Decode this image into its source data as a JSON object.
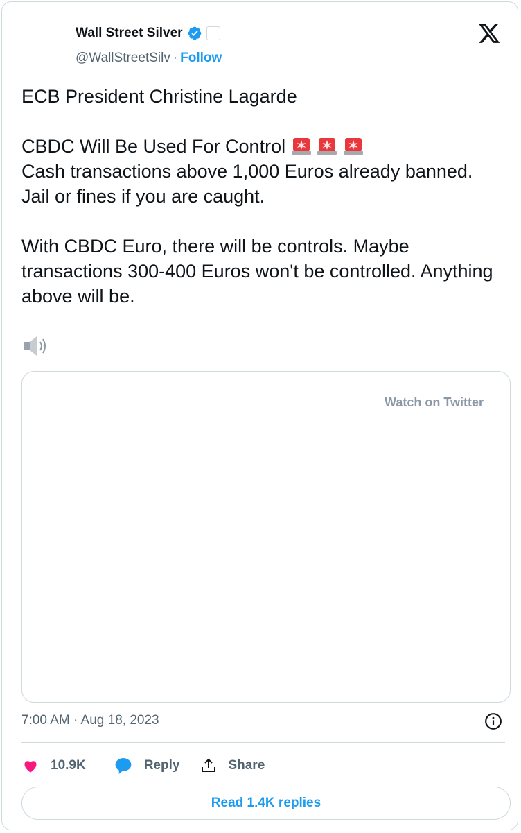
{
  "author": {
    "name": "Wall Street Silver",
    "handle": "@WallStreetSilv",
    "separator": "·",
    "follow_label": "Follow"
  },
  "tweet": {
    "line1": "ECB President Christine Lagarde",
    "line2": "CBDC Will Be Used For Control",
    "emoji": "rotating-light-emoji",
    "line3": "Cash transactions above 1,000 Euros already banned. Jail or fines if you are caught.",
    "line4": "With CBDC Euro, there will be controls. Maybe transactions 300-400 Euros won't be controlled. Anything above will be."
  },
  "media": {
    "watch_label": "Watch on Twitter"
  },
  "meta": {
    "timestamp": "7:00 AM · Aug 18, 2023"
  },
  "actions": {
    "likes": "10.9K",
    "reply_label": "Reply",
    "share_label": "Share"
  },
  "read_replies_label": "Read 1.4K replies",
  "colors": {
    "accent": "#1d9bf0",
    "like": "#f91880",
    "text": "#0f1419",
    "muted": "#536471",
    "border": "#cfd9de"
  },
  "icons": [
    "verified-badge-icon",
    "affiliate-badge-icon",
    "x-logo-icon",
    "speaker-icon",
    "heart-icon",
    "reply-bubble-icon",
    "share-icon",
    "info-icon"
  ]
}
